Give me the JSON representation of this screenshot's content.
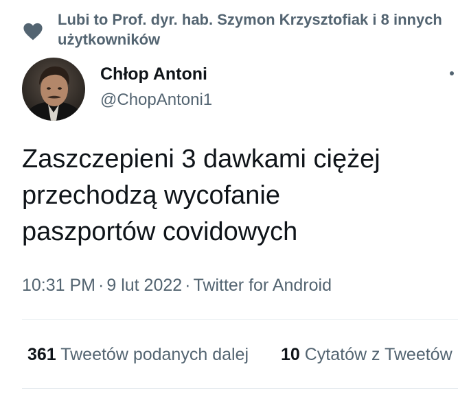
{
  "social_context": {
    "icon": "heart-icon",
    "text": "Lubi to Prof. dyr. hab. Szymon Krzysztofiak i 8 innych użytkowników"
  },
  "author": {
    "name": "Chłop Antoni",
    "handle": "@ChopAntoni1",
    "more_icon": "more-options-icon"
  },
  "tweet": {
    "text": "Zaszczepieni 3 dawkami ciężej\nprzechodzą wycofanie\npaszportów covidowych",
    "time": "10:31 PM",
    "date": "9 lut 2022",
    "source": "Twitter for Android",
    "separator": "·"
  },
  "stats": {
    "retweets": {
      "count": "361",
      "label": "Tweetów podanych dalej"
    },
    "quotes": {
      "count": "10",
      "label": "Cytatów z Tweetów"
    }
  },
  "colors": {
    "text_primary": "#0f1419",
    "text_secondary": "#536471",
    "divider": "#e6ecf0",
    "background": "#ffffff"
  }
}
